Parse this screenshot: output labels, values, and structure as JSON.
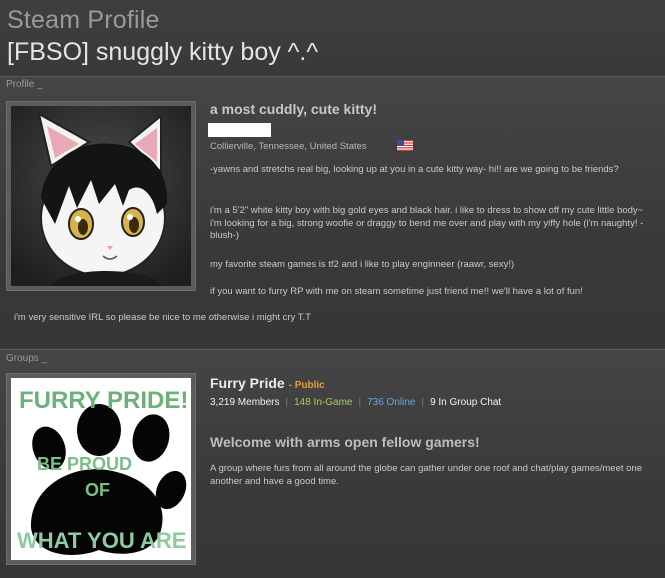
{
  "header": {
    "page_title": "Steam Profile",
    "profile_name": "[FBSO] snuggly kitty boy ^.^"
  },
  "profile": {
    "section_label": "Profile _",
    "headline": "a most cuddly, cute kitty!",
    "location": "Collierville, Tennessee, United States",
    "flag_icon": "us-flag-icon",
    "summary": [
      "-yawns and stretchs real big, looking up at you in a cute kitty way- hi!! are we going to be friends?",
      "i'm a 5'2\" white kitty boy with big gold eyes and black hair. i like to dress to show off my cute little body~ i'm looking for a big, strong woofie or draggy to bend me over and play with my yiffy hole (i'm naughty! -blush-)",
      "my favorite steam games is tf2 and i like to play enginneer (raawr, sexy!)",
      "if you want to furry RP with me on steam sometime just friend me!! we'll have a lot of fun!",
      "i'm very sensitive IRL so please be nice to me otherwise i might cry T.T"
    ]
  },
  "groups": {
    "section_label": "Groups _",
    "items": [
      {
        "name": "Furry Pride",
        "visibility": "- Public",
        "members": "3,219 Members",
        "in_game": "148 In-Game",
        "online": "736 Online",
        "in_chat": "9 In Group Chat",
        "headline": "Welcome with arms open fellow gamers!",
        "summary": "A group where furs from all around the globe can gather under one roof and chat/play games/meet one another and have a good time.",
        "logo_lettering": [
          "FURRY PRIDE!",
          "BE PROUD",
          "OF",
          "WHAT YOU ARE"
        ]
      }
    ]
  },
  "colors": {
    "background": "#3c3c3c",
    "public_accent": "#e89c3c",
    "in_game": "#a4cb5a",
    "online": "#62a7e3"
  }
}
